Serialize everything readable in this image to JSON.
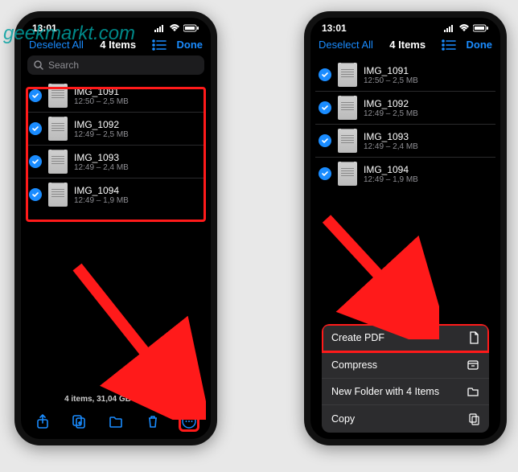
{
  "watermark": "geekmarkt.com",
  "colors": {
    "accent": "#1a8cff",
    "highlight": "#ff1a1a"
  },
  "status": {
    "time": "13:01"
  },
  "nav": {
    "deselect": "Deselect All",
    "title": "4 Items",
    "done": "Done"
  },
  "search": {
    "placeholder": "Search"
  },
  "files": [
    {
      "name": "IMG_1091",
      "sub": "12:50 – 2,5 MB"
    },
    {
      "name": "IMG_1092",
      "sub": "12:49 – 2,5 MB"
    },
    {
      "name": "IMG_1093",
      "sub": "12:49 – 2,4 MB"
    },
    {
      "name": "IMG_1094",
      "sub": "12:49 – 1,9 MB"
    }
  ],
  "footer": {
    "status": "4 items, 31,04 GB available"
  },
  "context_menu": [
    {
      "label": "Create PDF",
      "icon": "doc"
    },
    {
      "label": "Compress",
      "icon": "archive"
    },
    {
      "label": "New Folder with 4 Items",
      "icon": "folder"
    },
    {
      "label": "Copy",
      "icon": "copy"
    }
  ]
}
